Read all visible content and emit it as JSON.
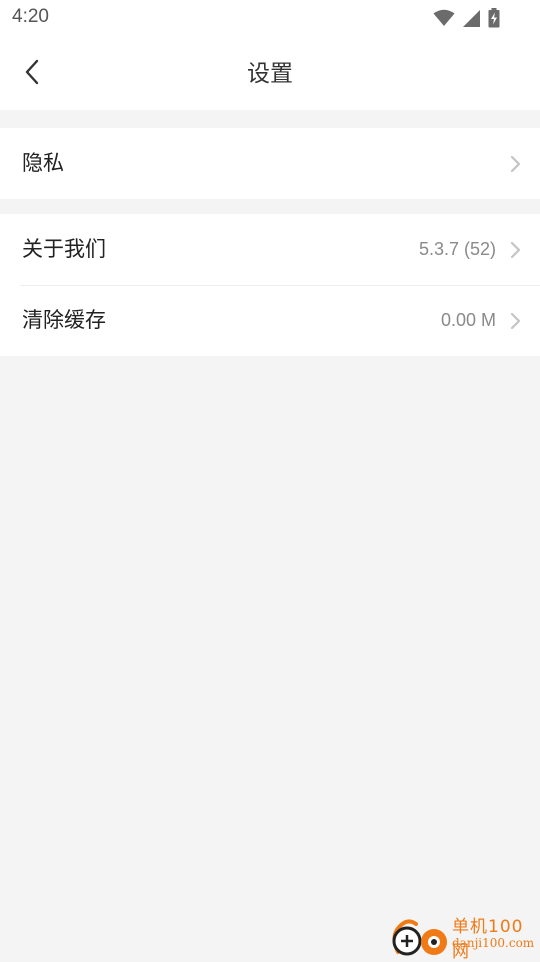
{
  "status_bar": {
    "time": "4:20"
  },
  "header": {
    "title": "设置"
  },
  "groups": [
    {
      "rows": [
        {
          "label": "隐私",
          "value": ""
        }
      ]
    },
    {
      "rows": [
        {
          "label": "关于我们",
          "value": "5.3.7 (52)"
        },
        {
          "label": "清除缓存",
          "value": "0.00 M"
        }
      ]
    }
  ],
  "icons": {
    "back": "back-arrow-icon",
    "chevron": "chevron-right-icon",
    "wifi": "wifi-icon",
    "signal": "cell-signal-icon",
    "battery": "battery-charging-icon"
  },
  "watermark": {
    "name": "单机100网",
    "url": "danji100.com"
  },
  "colors": {
    "background": "#f4f4f4",
    "surface": "#ffffff",
    "text_primary": "#222222",
    "text_secondary": "#8a8a8a",
    "watermark": "#f07a16"
  }
}
